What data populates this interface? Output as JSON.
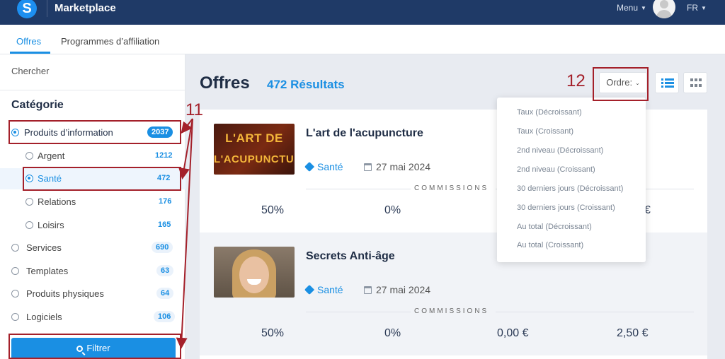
{
  "topbar": {
    "logo_letter": "S",
    "brand": "Marketplace",
    "menu_label": "Menu",
    "lang": "FR"
  },
  "tabs": [
    {
      "label": "Offres",
      "active": true
    },
    {
      "label": "Programmes d’affiliation",
      "active": false
    }
  ],
  "sidebar": {
    "search_label": "Chercher",
    "category_title": "Catégorie",
    "categories": [
      {
        "label": "Produits d’information",
        "count": "2037",
        "checked": true
      },
      {
        "label": "Argent",
        "count": "1212",
        "checked": false
      },
      {
        "label": "Santé",
        "count": "472",
        "checked": true
      },
      {
        "label": "Relations",
        "count": "176",
        "checked": false
      },
      {
        "label": "Loisirs",
        "count": "165",
        "checked": false
      },
      {
        "label": "Services",
        "count": "690",
        "checked": false
      },
      {
        "label": "Templates",
        "count": "63",
        "checked": false
      },
      {
        "label": "Produits physiques",
        "count": "64",
        "checked": false
      },
      {
        "label": "Logiciels",
        "count": "106",
        "checked": false
      }
    ],
    "filter_label": "Filtrer"
  },
  "main": {
    "title": "Offres",
    "results": "472 Résultats",
    "order_label": "Ordre:"
  },
  "order_options": [
    "Taux (Décroissant)",
    "Taux (Croissant)",
    "2nd niveau (Décroissant)",
    "2nd niveau (Croissant)",
    "30 derniers jours (Décroissant)",
    "30 derniers jours (Croissant)",
    "Au total (Décroissant)",
    "Au total (Croissant)"
  ],
  "offers": [
    {
      "title": "L'art de l'acupuncture",
      "thumb_text_1": "L'ART DE",
      "thumb_text_2": "L'ACUPUNCTURE",
      "tag": "Santé",
      "date": "27 mai 2024",
      "commissions_label": "COMMISSIONS",
      "values": [
        "50%",
        "0%",
        "€"
      ]
    },
    {
      "title": "Secrets Anti-âge",
      "tag": "Santé",
      "date": "27 mai 2024",
      "commissions_label": "COMMISSIONS",
      "values": [
        "50%",
        "0%",
        "0,00 €",
        "2,50 €"
      ]
    }
  ],
  "annotations": {
    "label_11": "11",
    "label_12": "12"
  },
  "colors": {
    "navbar": "#1f3a67",
    "accent": "#1a8fe3",
    "annotation": "#a4202a"
  }
}
